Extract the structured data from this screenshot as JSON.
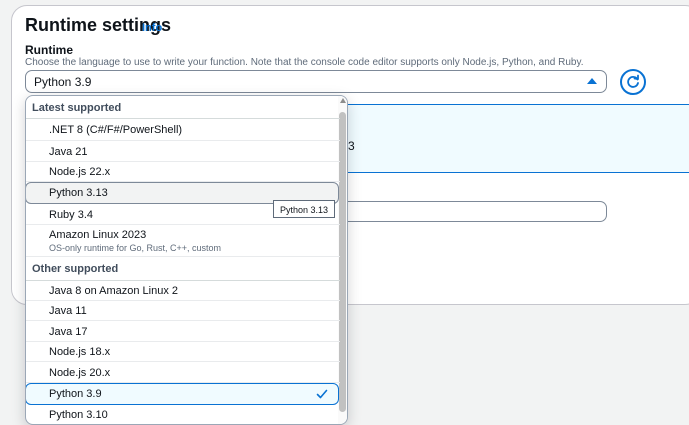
{
  "section": {
    "title": "Runtime settings",
    "info_link": "Info",
    "field_label": "Runtime",
    "field_description": "Choose the language to use to write your function. Note that the console code editor supports only Node.js, Python, and Ruby.",
    "selected_value": "Python 3.9",
    "info_box_partial_text": "3"
  },
  "dropdown": {
    "groups": [
      {
        "header": "Latest supported",
        "options": [
          {
            "label": ".NET 8 (C#/F#/PowerShell)"
          },
          {
            "label": "Java 21"
          },
          {
            "label": "Node.js 22.x"
          },
          {
            "label": "Python 3.13",
            "state": "hovered"
          },
          {
            "label": "Ruby 3.4"
          },
          {
            "label": "Amazon Linux 2023",
            "description": "OS-only runtime for Go, Rust, C++, custom"
          }
        ]
      },
      {
        "header": "Other supported",
        "options": [
          {
            "label": "Java 8 on Amazon Linux 2"
          },
          {
            "label": "Java 11"
          },
          {
            "label": "Java 17"
          },
          {
            "label": "Node.js 18.x"
          },
          {
            "label": "Node.js 20.x"
          },
          {
            "label": "Python 3.9",
            "state": "selected"
          },
          {
            "label": "Python 3.10"
          }
        ]
      }
    ],
    "tooltip": "Python 3.13"
  },
  "icons": {
    "refresh": "refresh-icon",
    "caret": "caret-up-icon",
    "check": "check-icon"
  },
  "colors": {
    "accent": "#0972d3",
    "text": "#0f141a",
    "muted": "#5f6b7a"
  }
}
